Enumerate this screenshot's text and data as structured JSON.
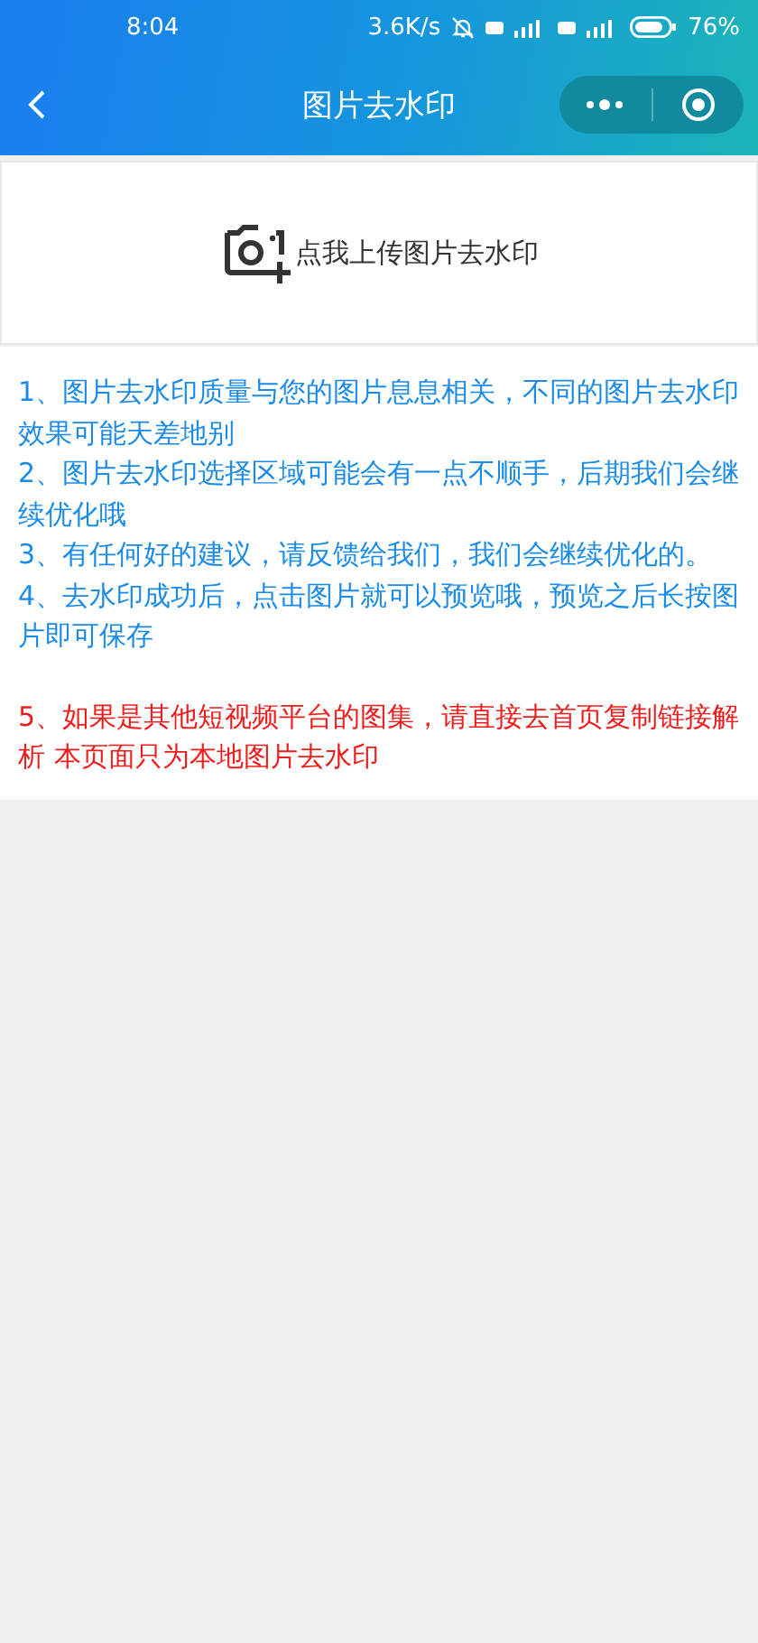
{
  "status_bar": {
    "time": "8:04",
    "speed": "3.6K/s",
    "battery": "76%"
  },
  "nav_bar": {
    "title": "图片去水印"
  },
  "upload": {
    "label": "点我上传图片去水印"
  },
  "notes": [
    {
      "kind": "info",
      "text": "1、图片去水印质量与您的图片息息相关，不同的图片去水印效果可能天差地别"
    },
    {
      "kind": "info",
      "text": "2、图片去水印选择区域可能会有一点不顺手，后期我们会继续优化哦"
    },
    {
      "kind": "info",
      "text": "3、有任何好的建议，请反馈给我们，我们会继续优化的。"
    },
    {
      "kind": "info",
      "text": "4、去水印成功后，点击图片就可以预览哦，预览之后长按图片即可保存"
    },
    {
      "kind": "warning",
      "text": "5、如果是其他短视频平台的图集，请直接去首页复制链接解析 本页面只为本地图片去水印"
    }
  ]
}
